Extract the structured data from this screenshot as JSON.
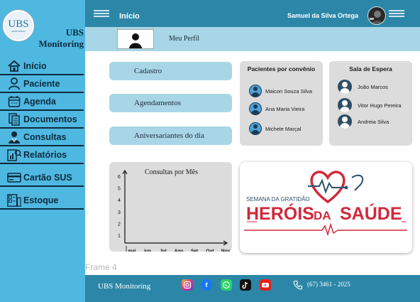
{
  "sidebar": {
    "logo_text": "UBS",
    "logo_sub": "MONITORING",
    "brand_line1": "UBS",
    "brand_line2": "Monitoring",
    "items": [
      {
        "label": "Início",
        "icon": "home-icon"
      },
      {
        "label": "Paciente",
        "icon": "person-icon"
      },
      {
        "label": "Agenda",
        "icon": "calendar-icon"
      },
      {
        "label": "Documentos",
        "icon": "documents-icon"
      },
      {
        "label": "Consultas",
        "icon": "doctor-icon"
      },
      {
        "label": "Relatórios",
        "icon": "reports-icon"
      },
      {
        "label": "Cartão SUS",
        "icon": "card-icon"
      },
      {
        "label": "Estoque",
        "icon": "stock-icon"
      }
    ]
  },
  "topbar": {
    "title": "Início",
    "user_name": "Samuel da Silva Ortega"
  },
  "profile": {
    "label": "Meu Perfil"
  },
  "actions": {
    "cadastro": "Cadastro",
    "agendamentos": "Agendamentos",
    "aniversariantes": "Aniversariantes do dia"
  },
  "patients_card": {
    "title": "Pacientes por convênio",
    "rows": [
      "Maicon Souza Silva",
      "Ana Maria Vieira",
      "Michele Marçal"
    ]
  },
  "waiting_card": {
    "title": "Sala de Espera",
    "rows": [
      "João Marcos",
      "Vitor Hugo Pereira",
      "Andreia Silva"
    ]
  },
  "chart_data": {
    "type": "bar",
    "title": "Consultas por Mês",
    "categories": [
      "mai",
      "jun",
      "Jul",
      "Ago",
      "Set",
      "Out",
      "Nov"
    ],
    "y_ticks": [
      "1",
      "2",
      "3",
      "4",
      "5",
      "6"
    ],
    "ylim": [
      0,
      6
    ],
    "values": []
  },
  "banner": {
    "line1": "SEMANA DA GRATIDÃO",
    "line2a": "HERÓIS",
    "line2b": "DA",
    "line2c": "SAÚDE"
  },
  "frame_label": "Frame 4",
  "footer": {
    "brand": "UBS Monitoring",
    "phone": "(67) 3461 - 2025",
    "socials": [
      "instagram-icon",
      "facebook-icon",
      "whatsapp-icon",
      "tiktok-icon",
      "youtube-icon"
    ]
  },
  "colors": {
    "sidebar": "#4fb8e0",
    "topbar": "#2c86a7",
    "light_blue": "#a8d6e6",
    "card_gray": "#dcdcdc",
    "banner_red": "#d0293b"
  }
}
